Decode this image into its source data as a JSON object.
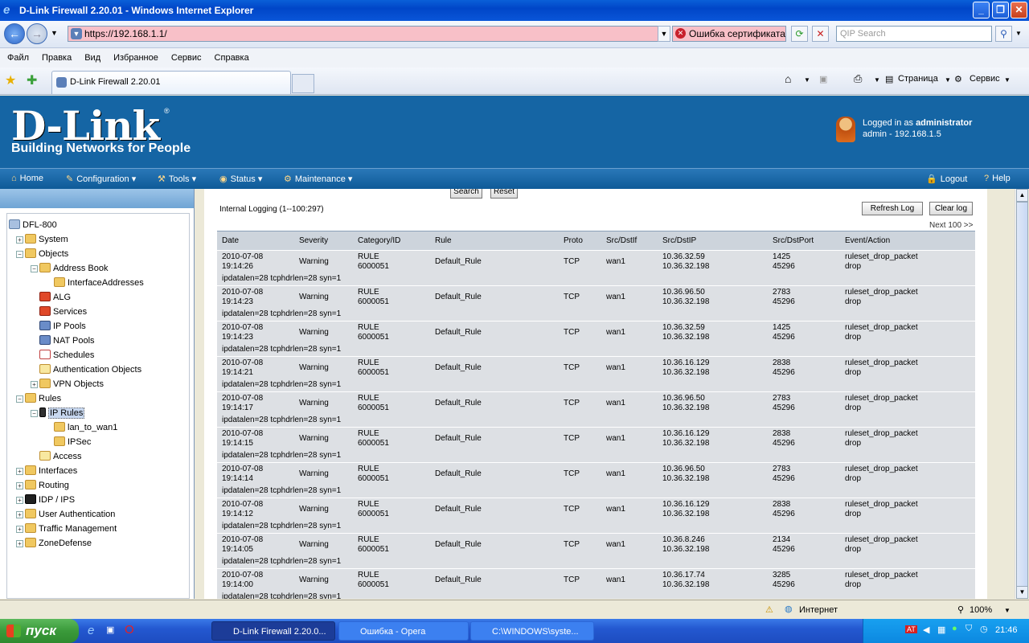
{
  "window": {
    "title": "D-Link Firewall 2.20.01 - Windows Internet Explorer"
  },
  "browser": {
    "url": "https://192.168.1.1/",
    "cert_error": "Ошибка сертификата",
    "search_placeholder": "QIP Search",
    "menu": [
      "Файл",
      "Правка",
      "Вид",
      "Избранное",
      "Сервис",
      "Справка"
    ],
    "tab_title": "D-Link Firewall 2.20.01",
    "page_label": "Страница",
    "tools_label": "Сервис"
  },
  "header": {
    "logo": "D-Link",
    "tagline": "Building Networks for People",
    "logged_in_prefix": "Logged in as ",
    "user": "administrator",
    "session": "admin - 192.168.1.5"
  },
  "nav": {
    "home": "Home",
    "configuration": "Configuration",
    "tools": "Tools",
    "status": "Status",
    "maintenance": "Maintenance",
    "logout": "Logout",
    "help": "Help"
  },
  "tree": {
    "root": "DFL-800",
    "system": "System",
    "objects": "Objects",
    "address_book": "Address Book",
    "interface_addresses": "InterfaceAddresses",
    "alg": "ALG",
    "services": "Services",
    "ip_pools": "IP Pools",
    "nat_pools": "NAT Pools",
    "schedules": "Schedules",
    "auth_objects": "Authentication Objects",
    "vpn_objects": "VPN Objects",
    "rules": "Rules",
    "ip_rules": "IP Rules",
    "lan_to_wan1": "lan_to_wan1",
    "ipsec": "IPSec",
    "access": "Access",
    "interfaces": "Interfaces",
    "routing": "Routing",
    "idp_ips": "IDP / IPS",
    "user_auth": "User Authentication",
    "traffic_mgmt": "Traffic Management",
    "zone_defense": "ZoneDefense"
  },
  "log": {
    "search_btn": "Search",
    "reset_btn": "Reset",
    "title": "Internal Logging (1--100:297)",
    "refresh_btn": "Refresh Log",
    "clear_btn": "Clear log",
    "next": "Next 100 >>",
    "headers": [
      "Date",
      "Severity",
      "Category/ID",
      "Rule",
      "Proto",
      "Src/DstIf",
      "Src/DstIP",
      "Src/DstPort",
      "Event/Action"
    ],
    "rows": [
      {
        "date": "2010-07-08",
        "time": "19:14:26",
        "sev": "Warning",
        "cat": "RULE",
        "id": "6000051",
        "rule": "Default_Rule",
        "proto": "TCP",
        "iface": "wan1",
        "src": "10.36.32.59",
        "dst": "10.36.32.198",
        "sport": "1425",
        "dport": "45296",
        "event": "ruleset_drop_packet",
        "action": "drop",
        "extra": "ipdatalen=28 tcphdrlen=28 syn=1"
      },
      {
        "date": "2010-07-08",
        "time": "19:14:23",
        "sev": "Warning",
        "cat": "RULE",
        "id": "6000051",
        "rule": "Default_Rule",
        "proto": "TCP",
        "iface": "wan1",
        "src": "10.36.96.50",
        "dst": "10.36.32.198",
        "sport": "2783",
        "dport": "45296",
        "event": "ruleset_drop_packet",
        "action": "drop",
        "extra": "ipdatalen=28 tcphdrlen=28 syn=1"
      },
      {
        "date": "2010-07-08",
        "time": "19:14:23",
        "sev": "Warning",
        "cat": "RULE",
        "id": "6000051",
        "rule": "Default_Rule",
        "proto": "TCP",
        "iface": "wan1",
        "src": "10.36.32.59",
        "dst": "10.36.32.198",
        "sport": "1425",
        "dport": "45296",
        "event": "ruleset_drop_packet",
        "action": "drop",
        "extra": "ipdatalen=28 tcphdrlen=28 syn=1"
      },
      {
        "date": "2010-07-08",
        "time": "19:14:21",
        "sev": "Warning",
        "cat": "RULE",
        "id": "6000051",
        "rule": "Default_Rule",
        "proto": "TCP",
        "iface": "wan1",
        "src": "10.36.16.129",
        "dst": "10.36.32.198",
        "sport": "2838",
        "dport": "45296",
        "event": "ruleset_drop_packet",
        "action": "drop",
        "extra": "ipdatalen=28 tcphdrlen=28 syn=1"
      },
      {
        "date": "2010-07-08",
        "time": "19:14:17",
        "sev": "Warning",
        "cat": "RULE",
        "id": "6000051",
        "rule": "Default_Rule",
        "proto": "TCP",
        "iface": "wan1",
        "src": "10.36.96.50",
        "dst": "10.36.32.198",
        "sport": "2783",
        "dport": "45296",
        "event": "ruleset_drop_packet",
        "action": "drop",
        "extra": "ipdatalen=28 tcphdrlen=28 syn=1"
      },
      {
        "date": "2010-07-08",
        "time": "19:14:15",
        "sev": "Warning",
        "cat": "RULE",
        "id": "6000051",
        "rule": "Default_Rule",
        "proto": "TCP",
        "iface": "wan1",
        "src": "10.36.16.129",
        "dst": "10.36.32.198",
        "sport": "2838",
        "dport": "45296",
        "event": "ruleset_drop_packet",
        "action": "drop",
        "extra": "ipdatalen=28 tcphdrlen=28 syn=1"
      },
      {
        "date": "2010-07-08",
        "time": "19:14:14",
        "sev": "Warning",
        "cat": "RULE",
        "id": "6000051",
        "rule": "Default_Rule",
        "proto": "TCP",
        "iface": "wan1",
        "src": "10.36.96.50",
        "dst": "10.36.32.198",
        "sport": "2783",
        "dport": "45296",
        "event": "ruleset_drop_packet",
        "action": "drop",
        "extra": "ipdatalen=28 tcphdrlen=28 syn=1"
      },
      {
        "date": "2010-07-08",
        "time": "19:14:12",
        "sev": "Warning",
        "cat": "RULE",
        "id": "6000051",
        "rule": "Default_Rule",
        "proto": "TCP",
        "iface": "wan1",
        "src": "10.36.16.129",
        "dst": "10.36.32.198",
        "sport": "2838",
        "dport": "45296",
        "event": "ruleset_drop_packet",
        "action": "drop",
        "extra": "ipdatalen=28 tcphdrlen=28 syn=1"
      },
      {
        "date": "2010-07-08",
        "time": "19:14:05",
        "sev": "Warning",
        "cat": "RULE",
        "id": "6000051",
        "rule": "Default_Rule",
        "proto": "TCP",
        "iface": "wan1",
        "src": "10.36.8.246",
        "dst": "10.36.32.198",
        "sport": "2134",
        "dport": "45296",
        "event": "ruleset_drop_packet",
        "action": "drop",
        "extra": "ipdatalen=28 tcphdrlen=28 syn=1"
      },
      {
        "date": "2010-07-08",
        "time": "19:14:00",
        "sev": "Warning",
        "cat": "RULE",
        "id": "6000051",
        "rule": "Default_Rule",
        "proto": "TCP",
        "iface": "wan1",
        "src": "10.36.17.74",
        "dst": "10.36.32.198",
        "sport": "3285",
        "dport": "45296",
        "event": "ruleset_drop_packet",
        "action": "drop",
        "extra": "ipdatalen=28 tcphdrlen=28 syn=1"
      }
    ]
  },
  "statusbar": {
    "zone": "Интернет",
    "zoom": "100%"
  },
  "taskbar": {
    "start": "пуск",
    "tasks": [
      "D-Link Firewall 2.20.0...",
      "Ошибка - Opera",
      "C:\\WINDOWS\\syste..."
    ],
    "lang": "EN",
    "clock": "21:46"
  }
}
